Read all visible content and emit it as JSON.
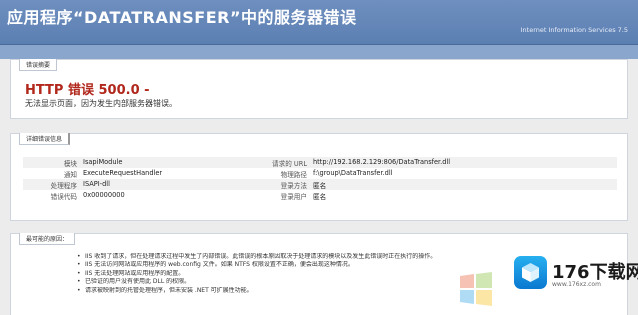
{
  "page": {
    "title": "应用程序“DATATRANSFER”中的服务器错误",
    "server": "Internet Information Services 7.5"
  },
  "error_summary": {
    "tab": "错误摘要",
    "heading": "HTTP 错误 500.0 -",
    "description": "无法显示页面，因为发生内部服务器错误。"
  },
  "details": {
    "tab": "详细错误信息",
    "left": [
      {
        "key": "模块",
        "value": "IsapiModule"
      },
      {
        "key": "通知",
        "value": "ExecuteRequestHandler"
      },
      {
        "key": "处理程序",
        "value": "ISAPI-dll"
      },
      {
        "key": "错误代码",
        "value": "0x00000000"
      }
    ],
    "right": [
      {
        "key": "请求的 URL",
        "value": "http://192.168.2.129:806/DataTransfer.dll"
      },
      {
        "key": "物理路径",
        "value": "f:\\group\\DataTransfer.dll"
      },
      {
        "key": "登录方法",
        "value": "匿名"
      },
      {
        "key": "登录用户",
        "value": "匿名"
      }
    ]
  },
  "causes": {
    "tab": "最可能的原因：",
    "items": [
      "IIS 收到了请求，但在处理请求过程中发生了内部错误。此错误的根本原因取决于处理请求的模块以及发生此错误时正在执行的操作。",
      "IIS 无法访问网站或应用程序的 web.config 文件。如果 NTFS 权限设置不正确，便会出现这种情况。",
      "IIS 无法处理网站或应用程序的配置。",
      "已验证的用户没有使用此 DLL 的权限。",
      "请求被映射到的托管处理程序，但未安装 .NET 可扩展性功能。"
    ]
  },
  "watermark": {
    "brand": "176下载网",
    "url": "www.176xz.com"
  }
}
